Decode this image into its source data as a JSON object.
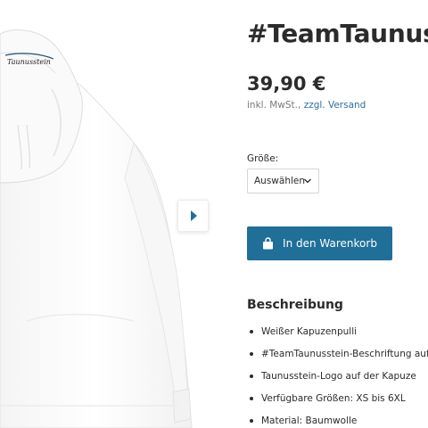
{
  "product": {
    "title": "#TeamTaunusstein",
    "price": "39,90 €",
    "tax_prefix": "inkl. MwSt., ",
    "shipping_link": "zzgl. Versand",
    "logo_text": "Taunusstein",
    "size_label": "Größe:",
    "size_select_value": "Auswählen",
    "cart_button_label": "In den Warenkorb",
    "description_heading": "Beschreibung",
    "description_items": [
      "Weißer Kapuzenpulli",
      "#TeamTaunusstein-Beschriftung auf der Brust",
      "Taunusstein-Logo auf der Kapuze",
      "Verfügbare Größen: XS bis 6XL",
      "Material: Baumwolle"
    ]
  },
  "icons": {
    "gallery_next": "chevron-right-icon",
    "select": "chevron-down-icon",
    "cart": "shopping-bag-icon"
  },
  "colors": {
    "accent": "#1f6f98",
    "link": "#2d6e9e",
    "text": "#2b2b2b",
    "muted": "#7a7a7a"
  }
}
